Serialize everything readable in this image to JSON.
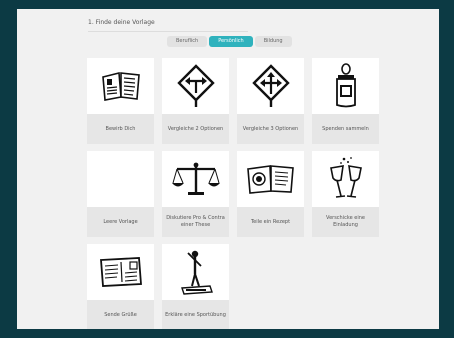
{
  "step": {
    "title": "1. Finde deine Vorlage"
  },
  "tabs": [
    {
      "label": "Beruflich",
      "active": false
    },
    {
      "label": "Persönlich",
      "active": true
    },
    {
      "label": "Bildung",
      "active": false
    }
  ],
  "templates": [
    {
      "label": "Bewirb Dich",
      "icon": "resume-book-icon"
    },
    {
      "label": "Vergleiche 2 Optionen",
      "icon": "two-way-sign-icon"
    },
    {
      "label": "Vergleiche 3 Optionen",
      "icon": "three-way-sign-icon"
    },
    {
      "label": "Spenden sammeln",
      "icon": "donation-jar-icon"
    },
    {
      "label": "Leere Vorlage",
      "icon": ""
    },
    {
      "label": "Diskutiere Pro & Contra einer These",
      "icon": "scales-icon"
    },
    {
      "label": "Teile ein Rezept",
      "icon": "recipe-book-icon"
    },
    {
      "label": "Verschicke eine Einladung",
      "icon": "champagne-glasses-icon"
    },
    {
      "label": "Sende Grüße",
      "icon": "postcard-icon"
    },
    {
      "label": "Erkläre eine Sportübung",
      "icon": "exercise-figure-icon"
    }
  ],
  "colors": {
    "frame": "#0c3a44",
    "accent": "#2fb2bd",
    "panel": "#f1f1f1"
  }
}
